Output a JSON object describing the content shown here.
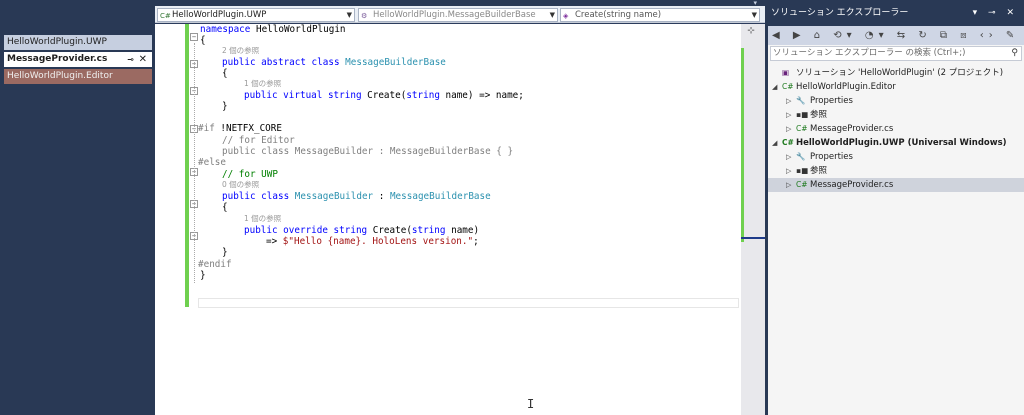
{
  "document_tabs": [
    {
      "label": "HelloWorldPlugin.UWP"
    },
    {
      "label": "MessageProvider.cs",
      "pin": "⊸",
      "close": "✕"
    },
    {
      "label": "HelloWorldPlugin.Editor"
    }
  ],
  "topstrip_caret": "▾",
  "nav": {
    "project": "HelloWorldPlugin.UWP",
    "type": "HelloWorldPlugin.MessageBuilderBase",
    "member": "Create(string name)",
    "project_icon": "C#",
    "type_icon": "⚙",
    "member_icon": "◈"
  },
  "code": {
    "l1_kw": "namespace",
    "l1_name": " HelloWorldPlugin",
    "l2": "{",
    "ref0": "2 個の参照",
    "l3_kw": "public abstract class",
    "l3_ty": "MessageBuilderBase",
    "l4": "{",
    "ref1": "1 個の参照",
    "l5_kw": "public virtual string",
    "l5_a": " Create(",
    "l5_kw2": "string",
    "l5_b": " name) => name;",
    "l6": "}",
    "l7_pp": "#if",
    "l7_rest": " !NETFX_CORE",
    "l8": "// for Editor",
    "l9": "public class MessageBuilder : MessageBuilderBase { }",
    "l10": "#else",
    "l11": "// for UWP",
    "ref2": "0 個の参照",
    "l12_kw": "public class",
    "l12_ty": "MessageBuilder",
    "l12_c": " : ",
    "l12_ty2": "MessageBuilderBase",
    "l13": "{",
    "ref3": "1 個の参照",
    "l14_kw": "public override string",
    "l14_a": " Create(",
    "l14_kw2": "string",
    "l14_b": " name)",
    "l15_a": "=> ",
    "l15_str": "$\"Hello {name}. HoloLens version.\"",
    "l15_b": ";",
    "l16": "}",
    "l17": "#endif",
    "l18": "}"
  },
  "scroll_split": "⊹",
  "ibeam": "I",
  "solution_explorer": {
    "title": "ソリューション エクスプローラー",
    "title_buttons": "▾ ⊸ ✕",
    "toolbar": "◀ ▶ ⌂ ⟲▾ ◔▾ ⇆ ↻ ⧉ ⧇ ‹› ✎",
    "search_placeholder": "ソリューション エクスプローラー の検索 (Ctrl+;)",
    "search_icon": "⚲",
    "tree": [
      {
        "label": "ソリューション 'HelloWorldPlugin' (2 プロジェクト)",
        "arrow": "",
        "icon": "▣"
      },
      {
        "label": "HelloWorldPlugin.Editor",
        "arrow": "◢",
        "icon": "C#"
      },
      {
        "label": "Properties",
        "arrow": "▷",
        "icon": "🔧"
      },
      {
        "label": "参照",
        "arrow": "▷",
        "icon": "▪■"
      },
      {
        "label": "MessageProvider.cs",
        "arrow": "▷",
        "icon": "C#"
      },
      {
        "label": "HelloWorldPlugin.UWP (Universal Windows)",
        "arrow": "◢",
        "icon": "C#"
      },
      {
        "label": "Properties",
        "arrow": "▷",
        "icon": "🔧"
      },
      {
        "label": "参照",
        "arrow": "▷",
        "icon": "▪■"
      },
      {
        "label": "MessageProvider.cs",
        "arrow": "▷",
        "icon": "C#"
      }
    ]
  },
  "colors": {
    "chrome": "#293955",
    "keyword": "#0000ff",
    "type": "#2b91af",
    "string": "#a31515",
    "comment": "#008000",
    "change_bar": "#6fd04f"
  }
}
